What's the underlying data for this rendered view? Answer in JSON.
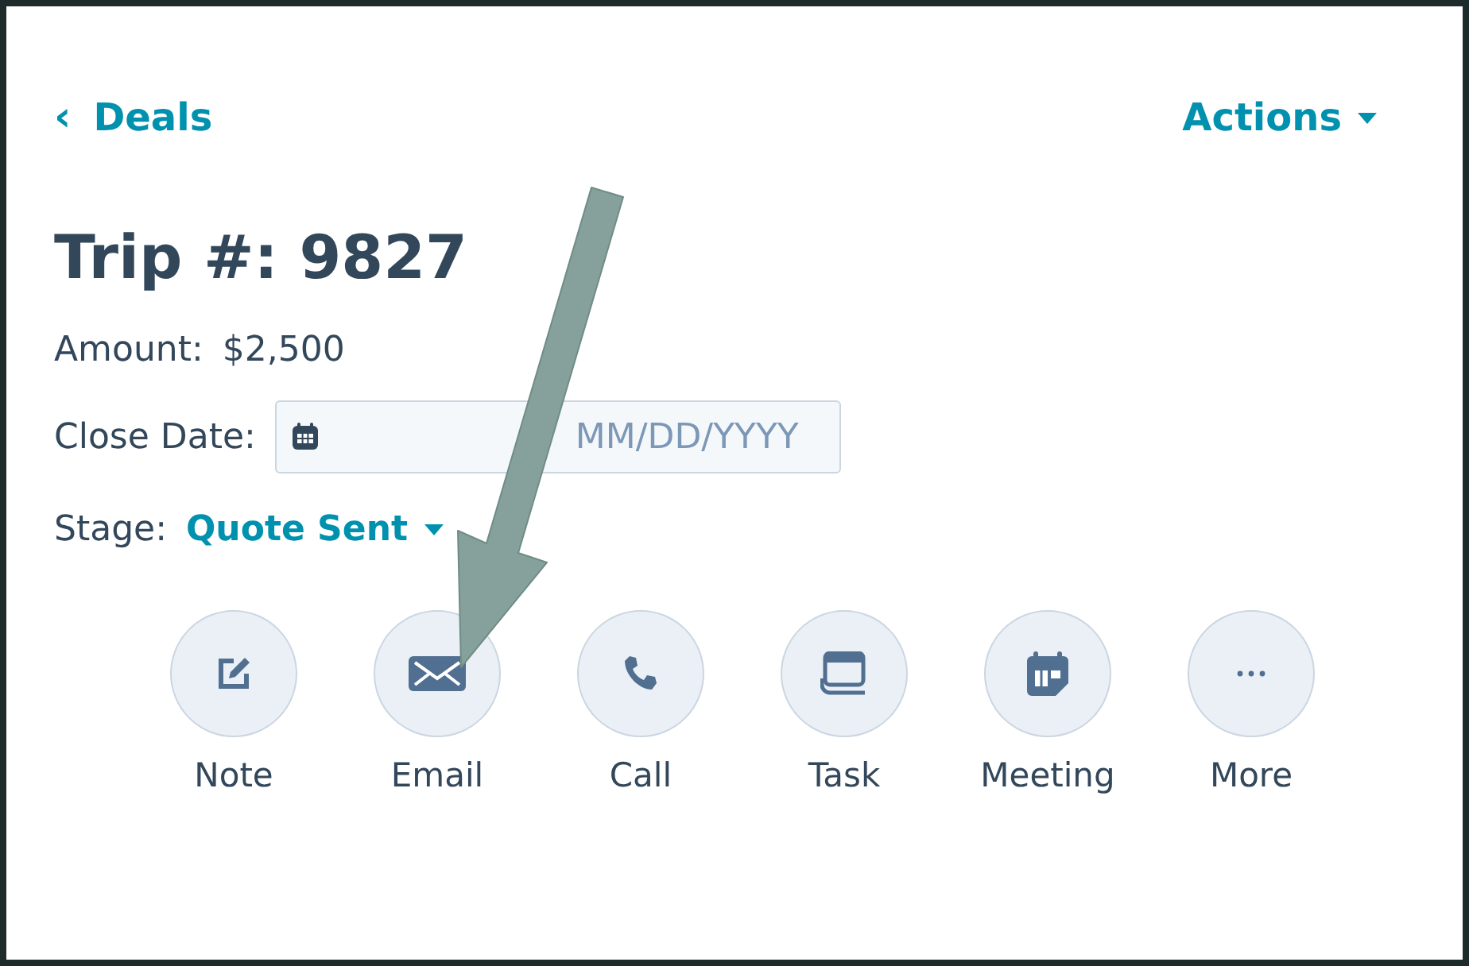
{
  "back_link": {
    "icon": "‹",
    "label": "Deals"
  },
  "actions_menu": {
    "label": "Actions"
  },
  "title": "Trip #: 9827",
  "fields": [
    {
      "kind": "text",
      "label": "Amount:",
      "value": "$2,500"
    },
    {
      "kind": "date",
      "label": "Close Date:",
      "placeholder": "MM/DD/YYYY"
    },
    {
      "kind": "dropdown",
      "label": "Stage:",
      "value": "Quote Sent"
    }
  ],
  "activity_buttons": [
    {
      "label": "Note"
    },
    {
      "label": "Email"
    },
    {
      "label": "Call"
    },
    {
      "label": "Task"
    },
    {
      "label": "Meeting"
    },
    {
      "label": "More"
    }
  ]
}
